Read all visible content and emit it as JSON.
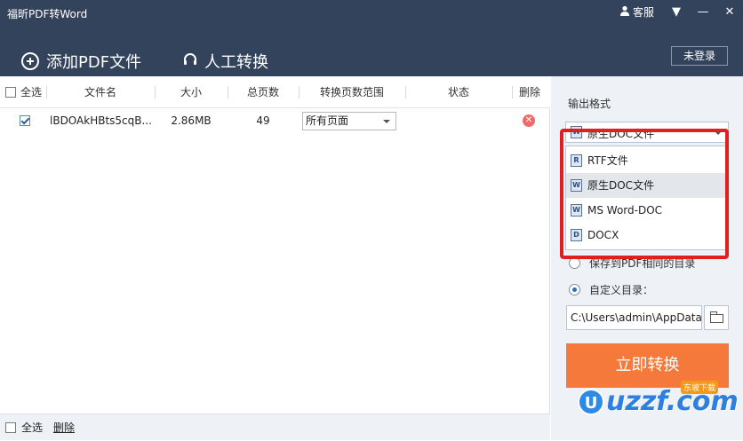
{
  "window": {
    "title": "福昕PDF转Word",
    "service_label": "客服",
    "menu_glyph": "▼",
    "minimize_glyph": "—",
    "close_glyph": "✕"
  },
  "toolbar": {
    "add_label": "添加PDF文件",
    "manual_label": "人工转换",
    "login_label": "未登录"
  },
  "table": {
    "headers": {
      "select_all": "全选",
      "filename": "文件名",
      "size": "大小",
      "pages": "总页数",
      "range": "转换页数范围",
      "status": "状态",
      "delete": "删除"
    },
    "rows": [
      {
        "checked": true,
        "filename": "lBDOAkHBts5cqB...",
        "size": "2.86MB",
        "pages": "49",
        "range": "所有页面",
        "status": ""
      }
    ]
  },
  "footer": {
    "select_all": "全选",
    "delete": "删除"
  },
  "side": {
    "output_format_label": "输出格式",
    "selected_format": "原生DOC文件",
    "options": [
      "RTF文件",
      "原生DOC文件",
      "MS Word-DOC",
      "DOCX"
    ],
    "save_same_dir_label": "保存到PDF相同的目录",
    "custom_dir_label": "自定义目录：",
    "custom_dir_path": "C:\\Users\\admin\\AppData",
    "convert_label": "立即转换"
  },
  "watermark": {
    "text": "uzzf.com",
    "tag": "东坡下载"
  },
  "colors": {
    "header_bg": "#33435b",
    "accent": "#f4793b",
    "highlight": "#e02020"
  }
}
